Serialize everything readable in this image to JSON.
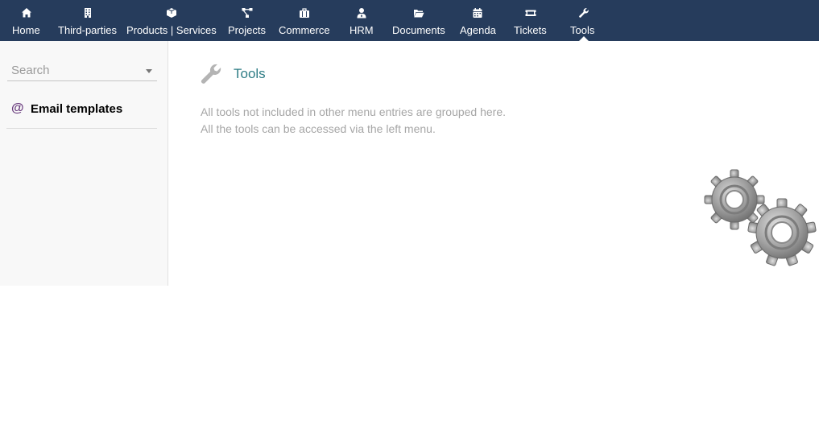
{
  "nav": {
    "items": [
      {
        "label": "Home",
        "icon": "home-icon"
      },
      {
        "label": "Third-parties",
        "icon": "building-icon"
      },
      {
        "label": "Products | Services",
        "icon": "cube-icon"
      },
      {
        "label": "Projects",
        "icon": "project-diagram-icon"
      },
      {
        "label": "Commerce",
        "icon": "briefcase-icon"
      },
      {
        "label": "HRM",
        "icon": "user-tie-icon"
      },
      {
        "label": "Documents",
        "icon": "folder-open-icon"
      },
      {
        "label": "Agenda",
        "icon": "calendar-icon"
      },
      {
        "label": "Tickets",
        "icon": "ticket-icon"
      },
      {
        "label": "Tools",
        "icon": "wrench-icon"
      }
    ],
    "active": "Tools",
    "bar_color": "#263c5c"
  },
  "sidebar": {
    "search_placeholder": "Search",
    "items": [
      {
        "label": "Email templates",
        "icon": "at-icon"
      }
    ]
  },
  "main": {
    "title": "Tools",
    "title_color": "#2f7d86",
    "description": [
      "All tools not included in other menu entries are grouped here.",
      "All the tools can be accessed via the left menu."
    ],
    "illustration": "gears-icon"
  }
}
